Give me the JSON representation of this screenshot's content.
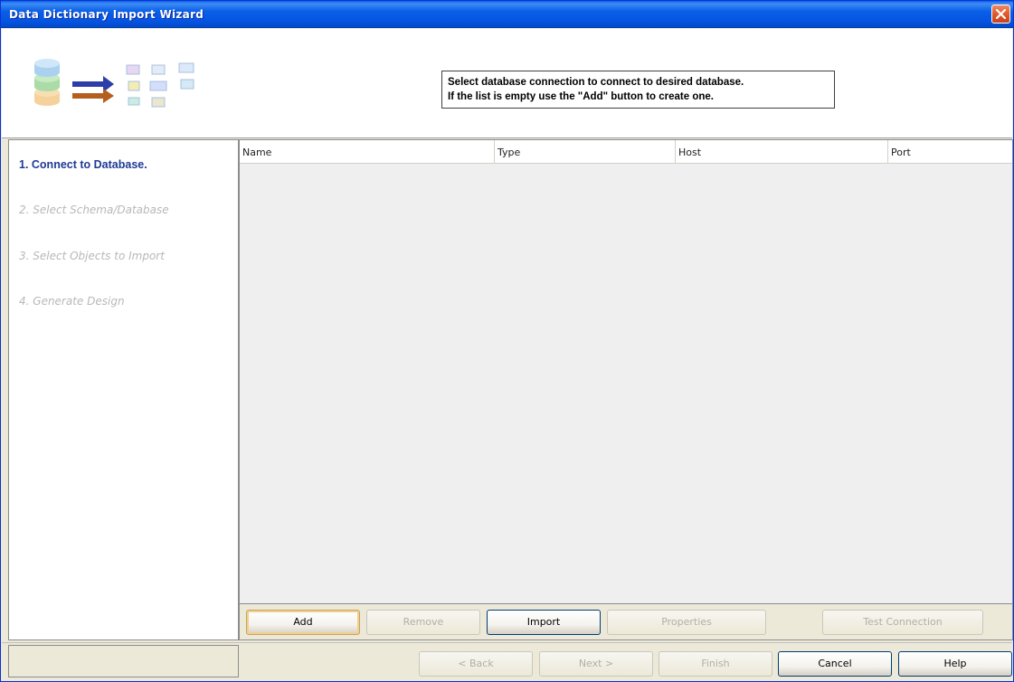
{
  "window": {
    "title": "Data Dictionary Import Wizard"
  },
  "header": {
    "instruction_line1": "Select database connection to connect to desired database.",
    "instruction_line2": "If the list is empty use the \"Add\" button to create one."
  },
  "steps": [
    {
      "label": "1. Connect to Database.",
      "active": true
    },
    {
      "label": "2. Select Schema/Database",
      "active": false
    },
    {
      "label": "3. Select Objects to Import",
      "active": false
    },
    {
      "label": "4. Generate Design",
      "active": false
    }
  ],
  "connections": {
    "columns": [
      "Name",
      "Type",
      "Host",
      "Port"
    ],
    "rows": []
  },
  "panel_buttons": {
    "add": "Add",
    "remove": "Remove",
    "import": "Import",
    "properties": "Properties",
    "test_connection": "Test Connection"
  },
  "nav_buttons": {
    "back": "< Back",
    "next": "Next >",
    "finish": "Finish",
    "cancel": "Cancel",
    "help": "Help"
  },
  "colors": {
    "titlebar": "#0a5fe7",
    "active_step": "#1e3a96",
    "inactive_step": "#b8b8b8",
    "default_button_border": "#c8a364"
  }
}
